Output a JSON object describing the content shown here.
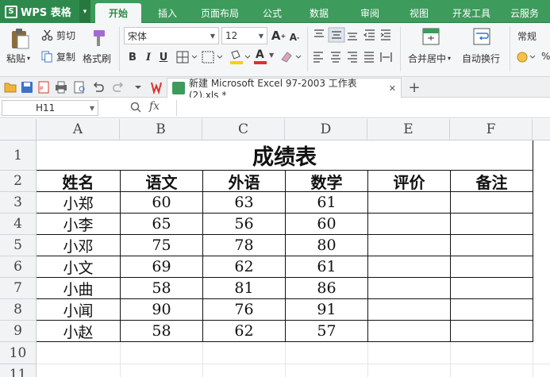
{
  "app": {
    "name": "WPS 表格",
    "logo_letter": "S",
    "menu_caret": "▾"
  },
  "menu_tabs": [
    "开始",
    "插入",
    "页面布局",
    "公式",
    "数据",
    "审阅",
    "视图",
    "开发工具",
    "云服务"
  ],
  "ribbon": {
    "paste": "粘贴",
    "cut": "剪切",
    "copy": "复制",
    "format_painter": "格式刷",
    "font_name": "宋体",
    "font_size": "12",
    "grow_font": "A",
    "shrink_font": "A",
    "bold": "B",
    "italic": "I",
    "underline": "U",
    "font_color_letter": "A",
    "merge_center": "合并居中",
    "wrap_text": "自动换行",
    "number_format": "常规",
    "percent": "%"
  },
  "document_tab": {
    "title": "新建 Microsoft Excel 97-2003 工作表 (2).xls *",
    "close": "✕",
    "add": "+"
  },
  "formula_bar": {
    "name_box": "H11",
    "fx": "fx"
  },
  "columns": [
    "A",
    "B",
    "C",
    "D",
    "E",
    "F"
  ],
  "rows": [
    "1",
    "2",
    "3",
    "4",
    "5",
    "6",
    "7",
    "8",
    "9",
    "10",
    "11"
  ],
  "sheet": {
    "title": "成绩表",
    "headers": [
      "姓名",
      "语文",
      "外语",
      "数学",
      "评价",
      "备注"
    ],
    "records": [
      [
        "小郑",
        "60",
        "63",
        "61"
      ],
      [
        "小李",
        "65",
        "56",
        "60"
      ],
      [
        "小邓",
        "75",
        "78",
        "80"
      ],
      [
        "小文",
        "69",
        "62",
        "61"
      ],
      [
        "小曲",
        "58",
        "81",
        "86"
      ],
      [
        "小闻",
        "90",
        "76",
        "91"
      ],
      [
        "小赵",
        "58",
        "62",
        "57"
      ]
    ]
  },
  "colors": {
    "brand_green": "#3d9b5c",
    "accent_red": "#d9342b",
    "highlight_yellow": "#f5d300"
  }
}
